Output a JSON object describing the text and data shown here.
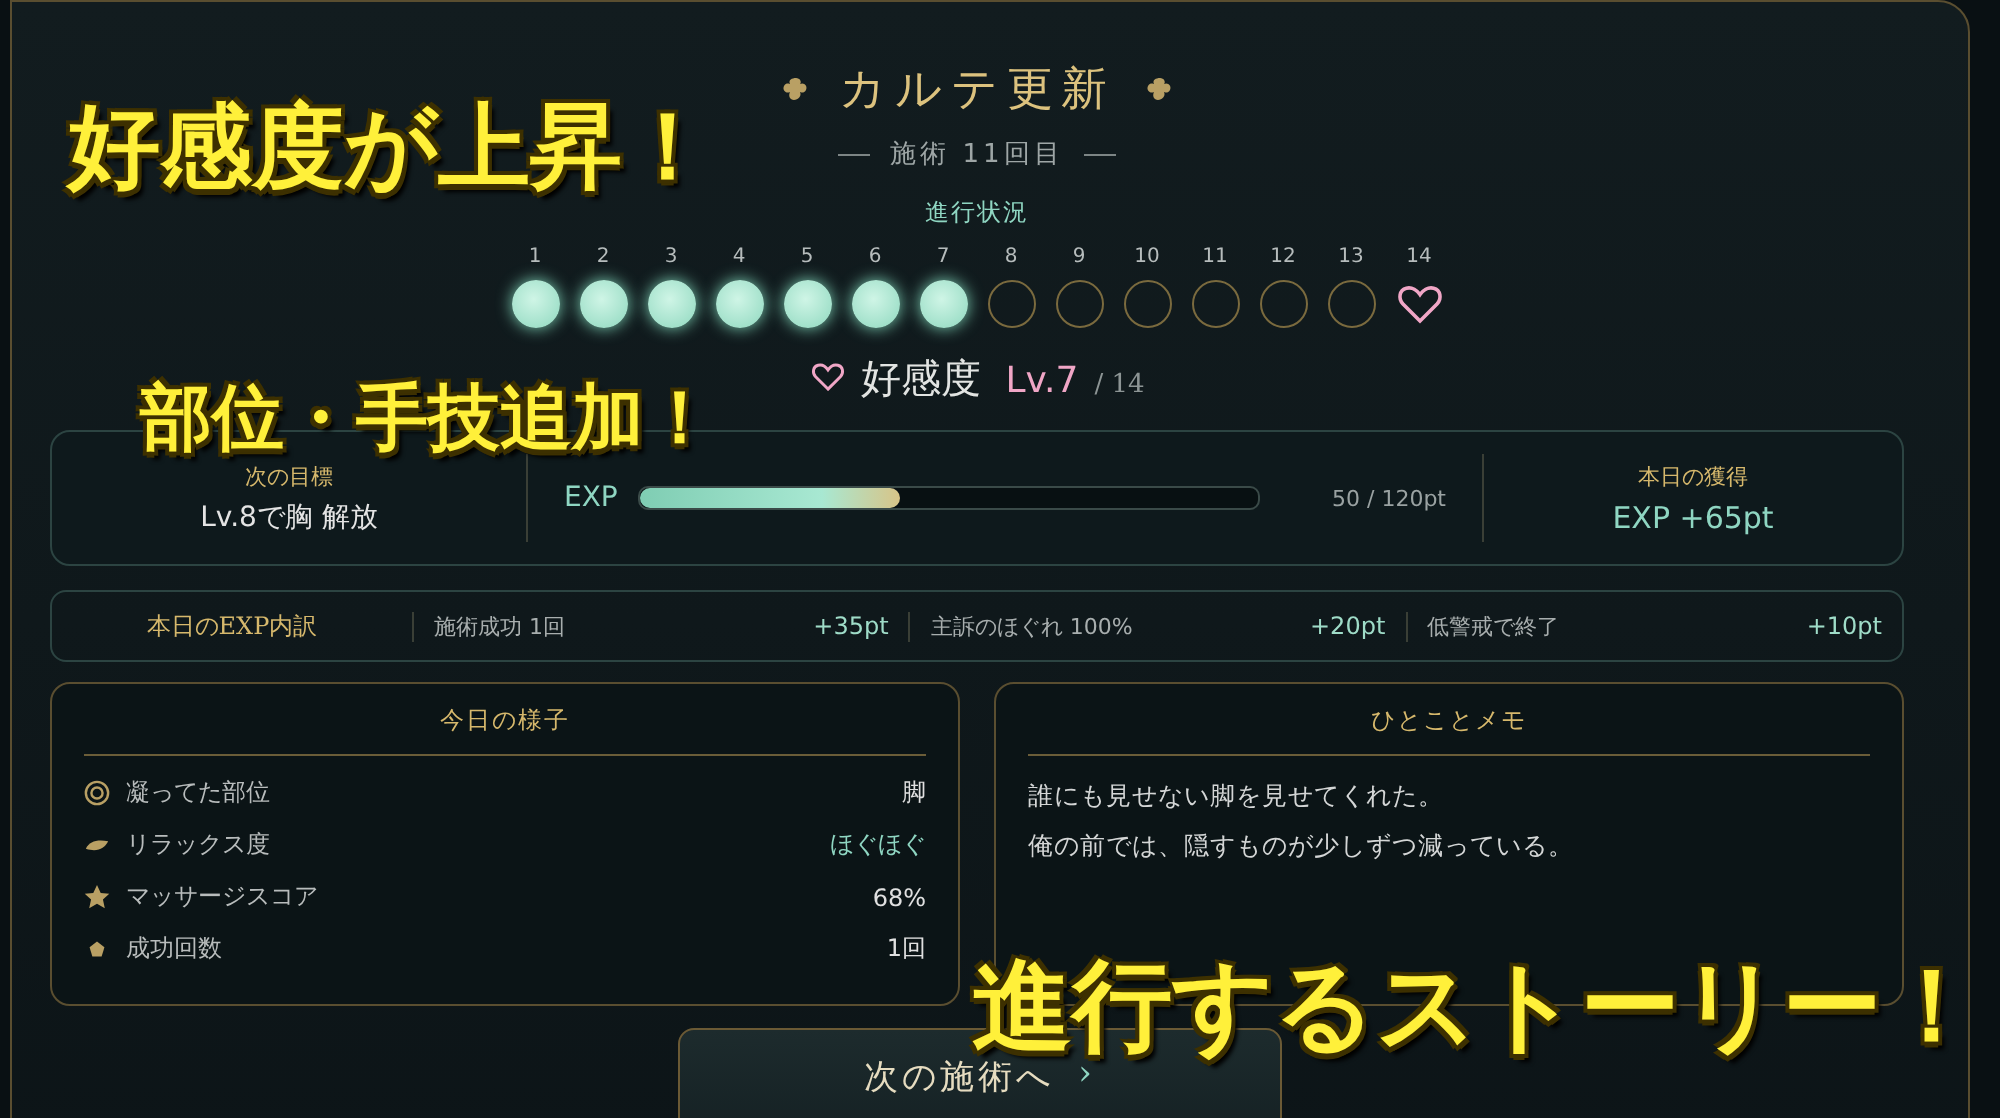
{
  "captions": [
    "好感度が上昇！",
    "部位・手技追加！",
    "進行するストーリー！"
  ],
  "header": {
    "title": "カルテ更新",
    "subtitle": "施術 11回目"
  },
  "progress": {
    "label": "進行状況",
    "steps": [
      {
        "number": "1",
        "kind": "circle",
        "done": true
      },
      {
        "number": "2",
        "kind": "circle",
        "done": true
      },
      {
        "number": "3",
        "kind": "circle",
        "done": true
      },
      {
        "number": "4",
        "kind": "circle",
        "done": true
      },
      {
        "number": "5",
        "kind": "circle",
        "done": true
      },
      {
        "number": "6",
        "kind": "circle",
        "done": true
      },
      {
        "number": "7",
        "kind": "circle",
        "done": true
      },
      {
        "number": "8",
        "kind": "circle",
        "done": false
      },
      {
        "number": "9",
        "kind": "circle",
        "done": false
      },
      {
        "number": "10",
        "kind": "circle",
        "done": false
      },
      {
        "number": "11",
        "kind": "circle",
        "done": false
      },
      {
        "number": "12",
        "kind": "circle",
        "done": false
      },
      {
        "number": "13",
        "kind": "circle",
        "done": false
      },
      {
        "number": "14",
        "kind": "heart",
        "done": false
      }
    ]
  },
  "affection": {
    "label": "好感度",
    "rank": "Lv.7",
    "total": "/ 14"
  },
  "summary": {
    "next_goal": {
      "label": "次の目標",
      "value": "Lv.8で胸 解放"
    },
    "exp": {
      "label": "EXP",
      "level": 0.42,
      "reading": "50 / 120pt"
    },
    "today_gain": {
      "label": "本日の獲得",
      "value": "EXP +65pt"
    }
  },
  "breakdown": {
    "title": "本日のEXP内訳",
    "items": [
      {
        "label": "施術成功 1回",
        "value": "+35pt"
      },
      {
        "label": "主訴のほぐれ 100%",
        "value": "+20pt"
      },
      {
        "label": "低警戒で終了",
        "value": "+10pt"
      }
    ]
  },
  "condition": {
    "title": "今日の様子",
    "rows": [
      {
        "kind": "target",
        "label": "凝ってた部位",
        "value": "脚",
        "accent": false
      },
      {
        "kind": "leaf",
        "label": "リラックス度",
        "value": "ほぐほぐ",
        "accent": true
      },
      {
        "kind": "star",
        "label": "マッサージスコア",
        "value": "68%",
        "accent": false
      },
      {
        "kind": "dot",
        "label": "成功回数",
        "value": "1回",
        "accent": false
      }
    ]
  },
  "memo": {
    "title": "ひとことメモ",
    "lines": [
      "誰にも見せない脚を見せてくれた。",
      "俺の前では、隠すものが少しずつ減っている。"
    ]
  },
  "next_button": {
    "label": "次の施術へ",
    "chevron": "›"
  }
}
